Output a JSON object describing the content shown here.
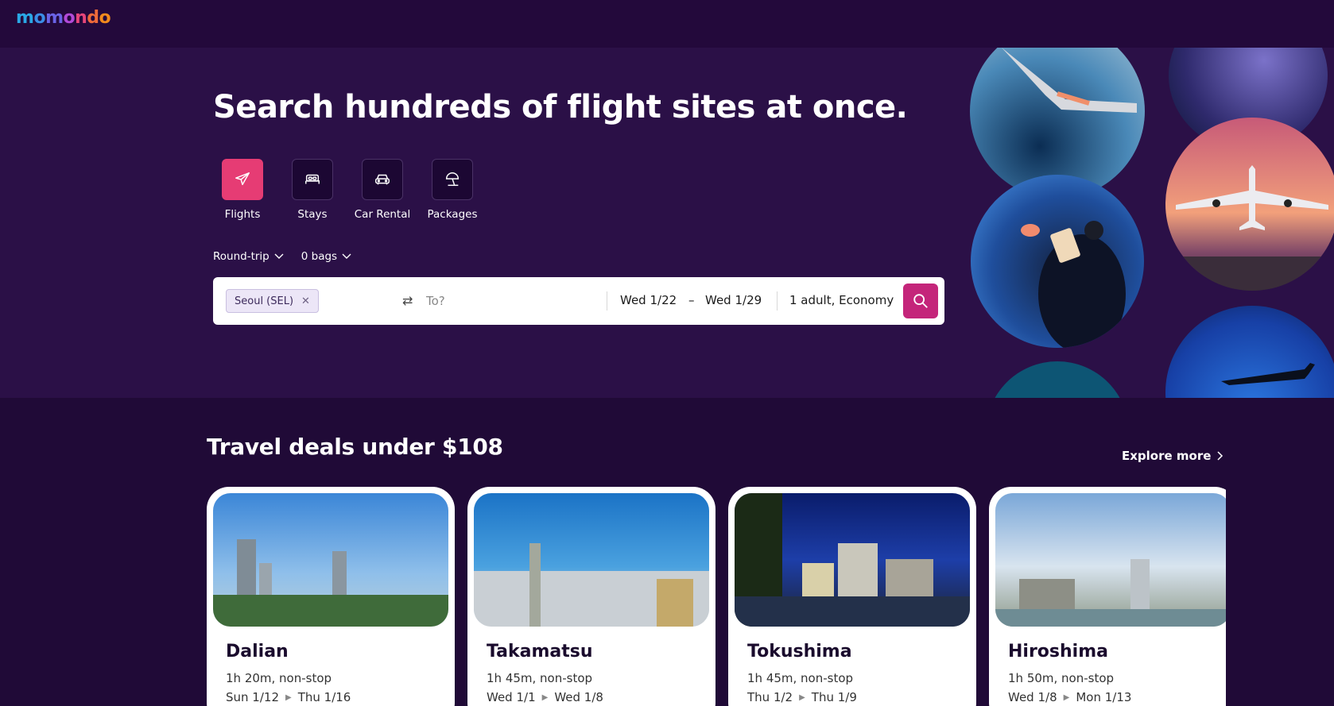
{
  "brand": {
    "name": "momondo",
    "letters": [
      "m",
      "o",
      "m",
      "o",
      "n",
      "d",
      "o"
    ],
    "colors": [
      "#2aa8e6",
      "#3a8ee6",
      "#6a63e6",
      "#b24ad8",
      "#e6457a",
      "#ee6a3a",
      "#f28a1d"
    ]
  },
  "hero": {
    "title": "Search hundreds of flight sites at once.",
    "verticals": [
      {
        "label": "Flights",
        "icon": "plane-icon",
        "active": true
      },
      {
        "label": "Stays",
        "icon": "bed-icon",
        "active": false
      },
      {
        "label": "Car Rental",
        "icon": "car-icon",
        "active": false
      },
      {
        "label": "Packages",
        "icon": "beach-umbrella-icon",
        "active": false
      }
    ],
    "trip_type": "Round-trip",
    "bags": "0 bags"
  },
  "search": {
    "origin_chip": "Seoul (SEL)",
    "destination_placeholder": "To?",
    "depart_date": "Wed 1/22",
    "date_separator": "–",
    "return_date": "Wed 1/29",
    "travelers": "1 adult, Economy"
  },
  "deals": {
    "title": "Travel deals under $108",
    "explore_label": "Explore more",
    "cards": [
      {
        "city": "Dalian",
        "meta": "1h 20m, non-stop",
        "depart": "Sun 1/12",
        "return": "Thu 1/16"
      },
      {
        "city": "Takamatsu",
        "meta": "1h 45m, non-stop",
        "depart": "Wed 1/1",
        "return": "Wed 1/8"
      },
      {
        "city": "Tokushima",
        "meta": "1h 45m, non-stop",
        "depart": "Thu 1/2",
        "return": "Thu 1/9"
      },
      {
        "city": "Hiroshima",
        "meta": "1h 50m, non-stop",
        "depart": "Wed 1/8",
        "return": "Mon 1/13"
      }
    ]
  },
  "colors": {
    "topbar": "#23093b",
    "hero": "#2b1047",
    "page": "#200a37",
    "accent": "#e63c74",
    "search_button": "#c4257a"
  }
}
